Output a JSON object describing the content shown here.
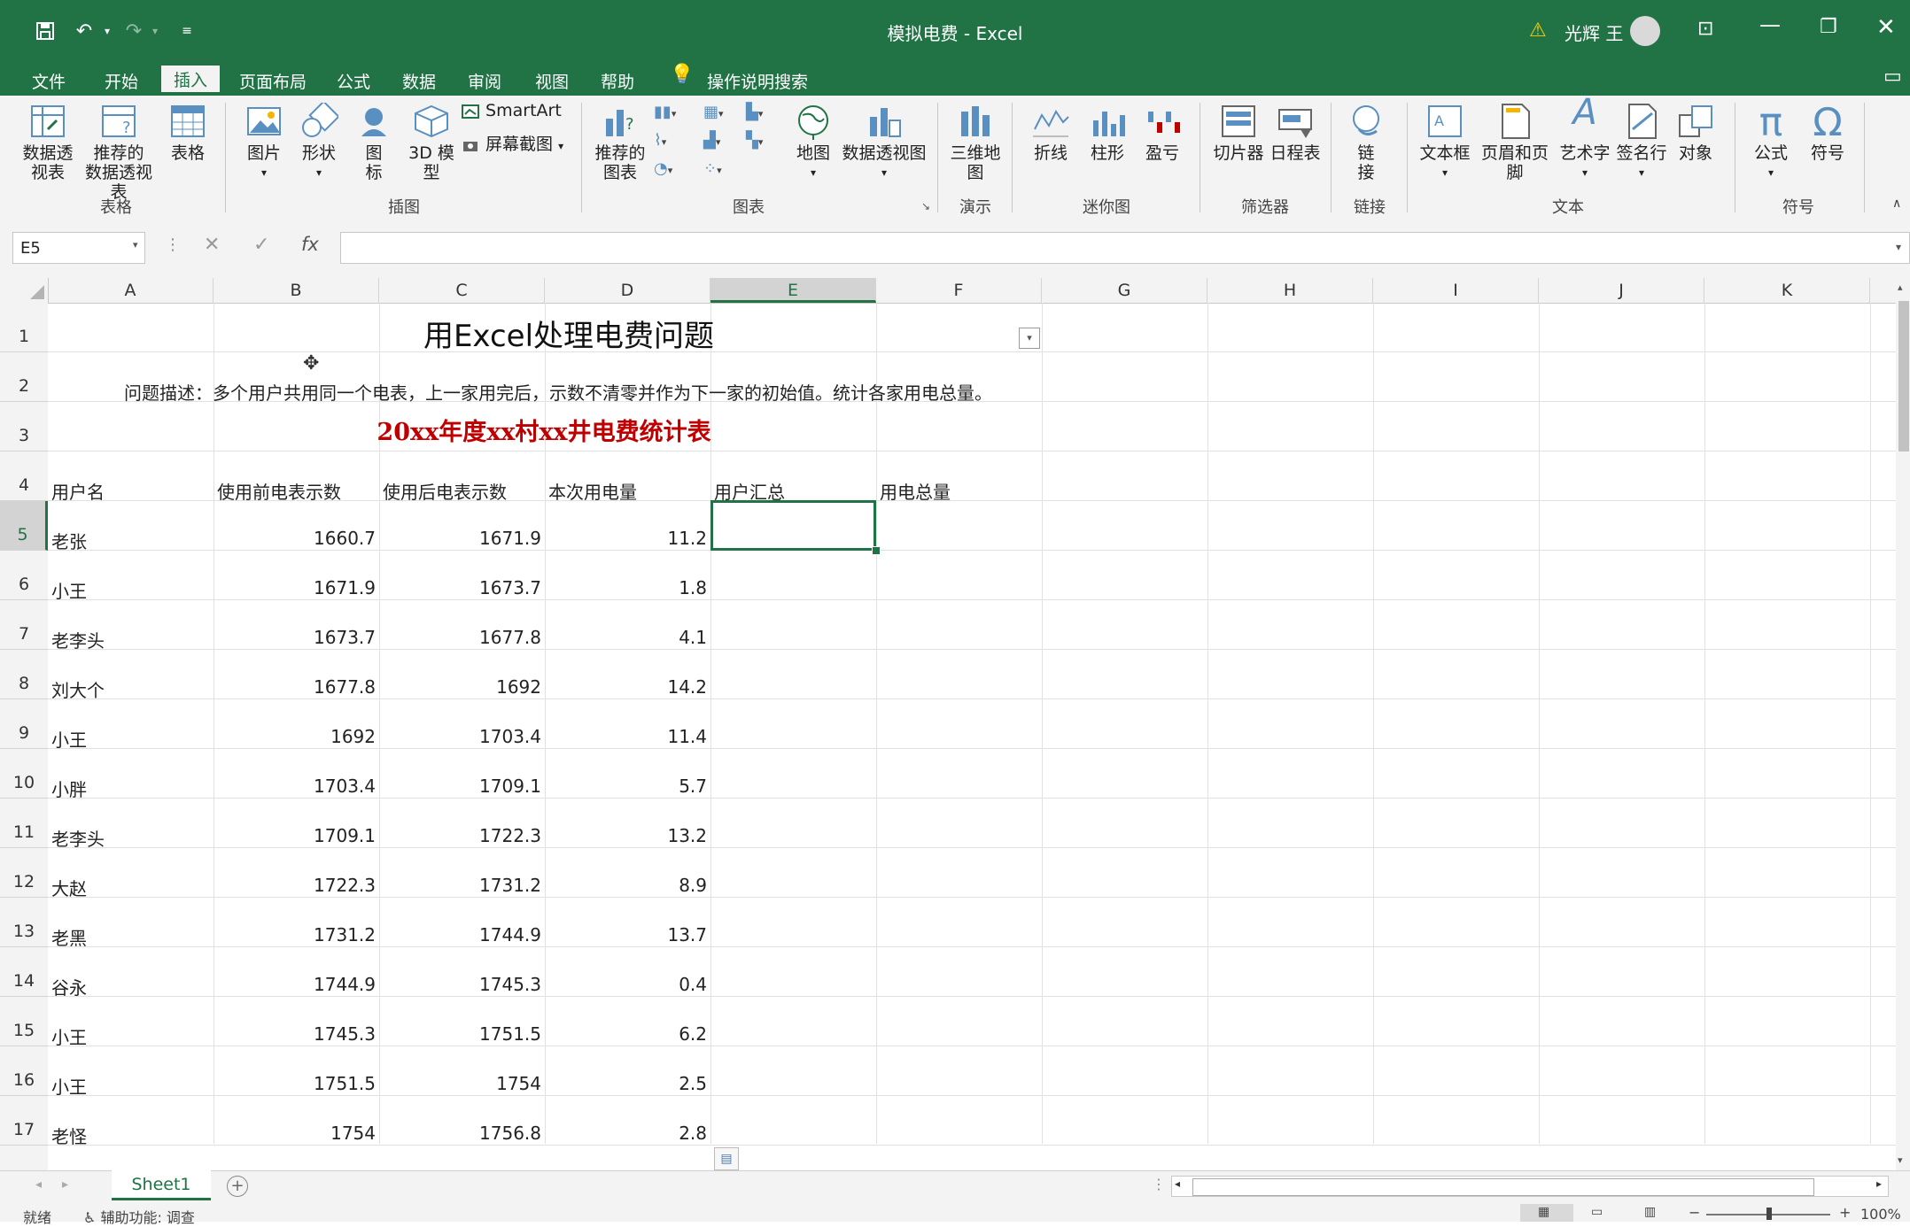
{
  "window": {
    "title": "模拟电费 - Excel",
    "user": "光辉 王"
  },
  "tabs": [
    "文件",
    "开始",
    "插入",
    "页面布局",
    "公式",
    "数据",
    "审阅",
    "视图",
    "帮助"
  ],
  "active_tab": "插入",
  "search_label": "操作说明搜索",
  "ribbon": {
    "groups": {
      "tables": "表格",
      "illustrations": "插图",
      "charts": "图表",
      "tours": "演示",
      "sparklines": "迷你图",
      "filters": "筛选器",
      "links": "链接",
      "text": "文本",
      "symbols": "符号"
    },
    "pivot1": "数据透",
    "pivot2": "视表",
    "recpivot1": "推荐的",
    "recpivot2": "数据透视表",
    "table": "表格",
    "picture": "图片",
    "shapes": "形状",
    "icons1": "图",
    "icons2": "标",
    "model1": "3D 模",
    "model2": "型",
    "smartart": "SmartArt",
    "screenshot": "屏幕截图",
    "reccharts1": "推荐的",
    "reccharts2": "图表",
    "maps": "地图",
    "pivotchart": "数据透视图",
    "map3d1": "三维地",
    "map3d2": "图",
    "line": "折线",
    "column": "柱形",
    "winloss": "盈亏",
    "slicer": "切片器",
    "timeline": "日程表",
    "link1": "链",
    "link2": "接",
    "textbox": "文本框",
    "headerfooter": "页眉和页脚",
    "wordart": "艺术字",
    "sigline": "签名行",
    "object": "对象",
    "equation": "公式",
    "symbol": "符号"
  },
  "namebox": "E5",
  "columns": [
    "A",
    "B",
    "C",
    "D",
    "E",
    "F",
    "G",
    "H",
    "I",
    "J",
    "K"
  ],
  "rows": [
    "1",
    "2",
    "3",
    "4",
    "5",
    "6",
    "7",
    "8",
    "9",
    "10",
    "11",
    "12",
    "13",
    "14",
    "15",
    "16",
    "17"
  ],
  "sheet": {
    "title": "用Excel处理电费问题",
    "description": "问题描述：多个用户共用同一个电表，上一家用完后，示数不清零并作为下一家的初始值。统计各家用电总量。",
    "subtitle": "20xx年度xx村xx井电费统计表",
    "subtitle_color": "#c00000",
    "headers": [
      "用户名",
      "使用前电表示数",
      "使用后电表示数",
      "本次用电量",
      "用户汇总",
      "用电总量"
    ],
    "data": [
      [
        "老张",
        "1660.7",
        "1671.9",
        "11.2"
      ],
      [
        "小王",
        "1671.9",
        "1673.7",
        "1.8"
      ],
      [
        "老李头",
        "1673.7",
        "1677.8",
        "4.1"
      ],
      [
        "刘大个",
        "1677.8",
        "1692",
        "14.2"
      ],
      [
        "小王",
        "1692",
        "1703.4",
        "11.4"
      ],
      [
        "小胖",
        "1703.4",
        "1709.1",
        "5.7"
      ],
      [
        "老李头",
        "1709.1",
        "1722.3",
        "13.2"
      ],
      [
        "大赵",
        "1722.3",
        "1731.2",
        "8.9"
      ],
      [
        "老黑",
        "1731.2",
        "1744.9",
        "13.7"
      ],
      [
        "谷永",
        "1744.9",
        "1745.3",
        "0.4"
      ],
      [
        "小王",
        "1745.3",
        "1751.5",
        "6.2"
      ],
      [
        "小王",
        "1751.5",
        "1754",
        "2.5"
      ],
      [
        "老怪",
        "1754",
        "1756.8",
        "2.8"
      ]
    ]
  },
  "sheet_tab": "Sheet1",
  "status": {
    "ready": "就绪",
    "accessibility": "辅助功能: 调查",
    "zoom": "100%"
  },
  "accent": "#217346"
}
